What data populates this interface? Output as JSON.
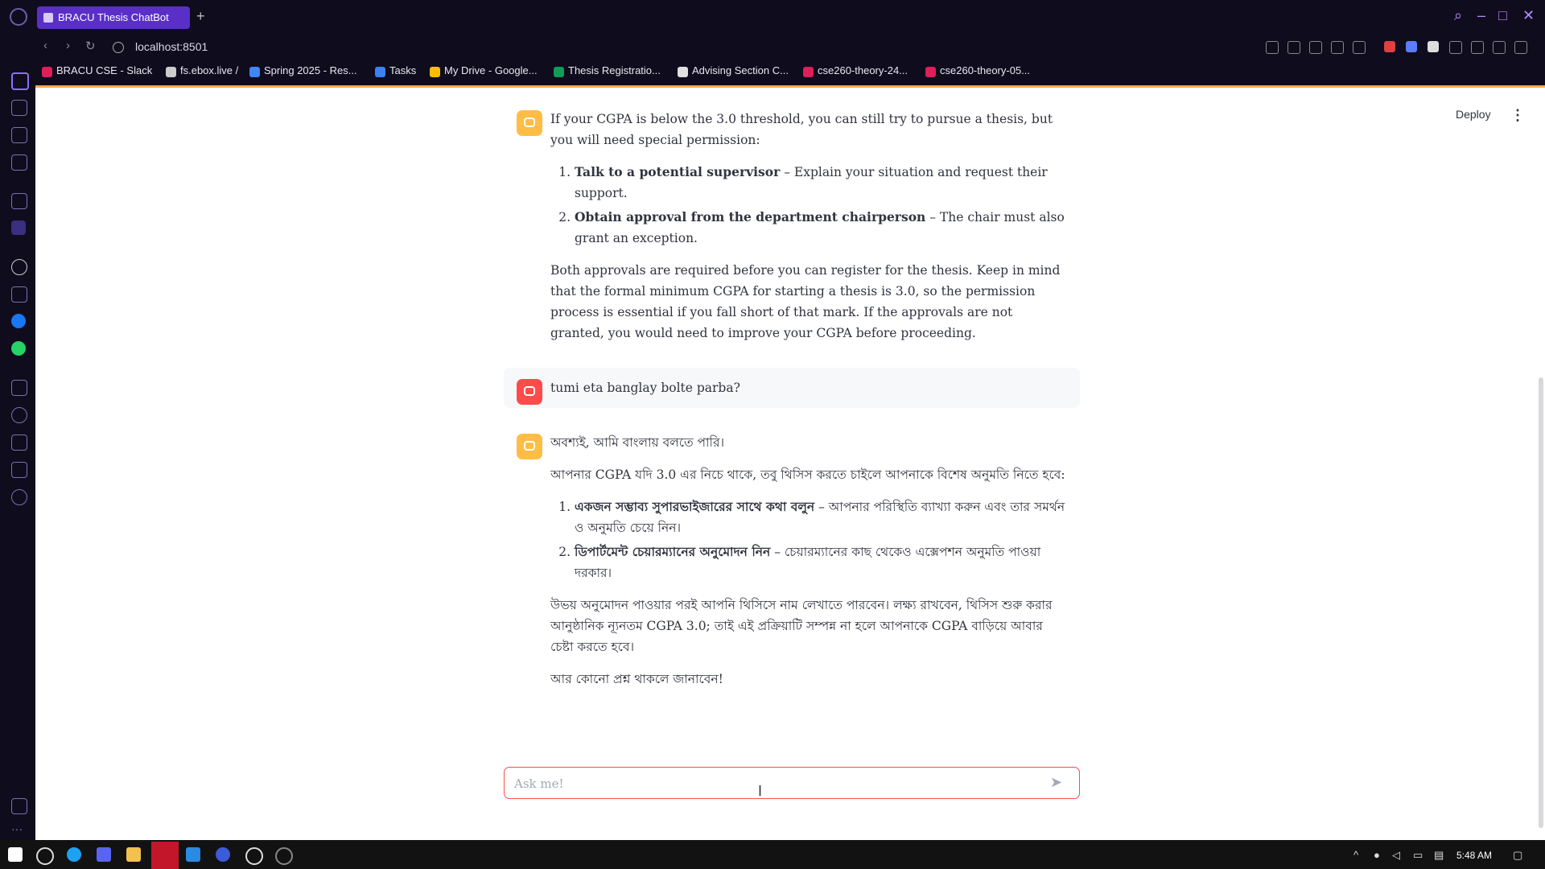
{
  "window": {
    "tab_title": "BRACU Thesis ChatBot",
    "url": "localhost:8501"
  },
  "bookmarks": [
    {
      "label": "BRACU CSE - Slack",
      "icon": "slack-icon",
      "color": "#e01e5a"
    },
    {
      "label": "fs.ebox.live /",
      "icon": "file-icon",
      "color": "#cccccc"
    },
    {
      "label": "Spring 2025 - Res...",
      "icon": "google-icon",
      "color": "#4285f4"
    },
    {
      "label": "Tasks",
      "icon": "tasks-icon",
      "color": "#3b82f6"
    },
    {
      "label": "My Drive - Google...",
      "icon": "drive-icon",
      "color": "#fbbc04"
    },
    {
      "label": "Thesis Registratio...",
      "icon": "sheets-icon",
      "color": "#0f9d58"
    },
    {
      "label": "Advising Section C...",
      "icon": "doc-icon",
      "color": "#e0e0e0"
    },
    {
      "label": "cse260-theory-24...",
      "icon": "slack-icon",
      "color": "#e01e5a"
    },
    {
      "label": "cse260-theory-05...",
      "icon": "slack-icon",
      "color": "#e01e5a"
    }
  ],
  "app": {
    "deploy_label": "Deploy",
    "menu_icon": "kebab-menu-icon"
  },
  "messages": {
    "m1": {
      "role": "assistant",
      "intro": "If your CGPA is below the 3.0 threshold, you can still try to pursue a thesis, but you will need special permission:",
      "items": [
        {
          "bold": "Talk to a potential supervisor",
          "text": " – Explain your situation and request their support."
        },
        {
          "bold": "Obtain approval from the department chairperson",
          "text": " – The chair must also grant an exception."
        }
      ],
      "outro": "Both approvals are required before you can register for the thesis. Keep in mind that the formal minimum CGPA for starting a thesis is 3.0, so the permission process is essential if you fall short of that mark. If the approvals are not granted, you would need to improve your CGPA before proceeding."
    },
    "m2": {
      "role": "user",
      "text": "tumi eta banglay bolte parba?"
    },
    "m3": {
      "role": "assistant",
      "greeting": "অবশ্যই, আমি বাংলায় বলতে পারি।",
      "intro": "আপনার CGPA যদি 3.0 এর নিচে থাকে, তবু থিসিস করতে চাইলে আপনাকে বিশেষ অনুমতি নিতে হবে:",
      "items": [
        {
          "bold": "একজন সম্ভাব্য সুপারভাইজারের সাথে কথা বলুন",
          "text": " – আপনার পরিস্থিতি ব্যাখ্যা করুন এবং তার সমর্থন ও অনুমতি চেয়ে নিন।"
        },
        {
          "bold": "ডিপার্টমেন্ট চেয়ারম্যানের অনুমোদন নিন",
          "text": " – চেয়ারম্যানের কাছ থেকেও এক্সেপশন অনুমতি পাওয়া দরকার।"
        }
      ],
      "outro": "উভয় অনুমোদন পাওয়ার পরই আপনি থিসিসে নাম লেখাতে পারবেন। লক্ষ্য রাখবেন, থিসিস শুরু করার আনুষ্ঠানিক ন্যূনতম CGPA 3.0; তাই এই প্রক্রিয়াটি সম্পন্ন না হলে আপনাকে CGPA বাড়িয়ে আবার চেষ্টা করতে হবে।",
      "closing": "আর কোনো প্রশ্ন থাকলে জানাবেন!"
    }
  },
  "chat_input": {
    "placeholder": "Ask me!",
    "value": ""
  },
  "taskbar": {
    "time": "5:48 AM"
  },
  "colors": {
    "accent": "#ff4b4b",
    "bot_avatar": "#ffbd45",
    "browser_accent": "#5a2fc7"
  }
}
